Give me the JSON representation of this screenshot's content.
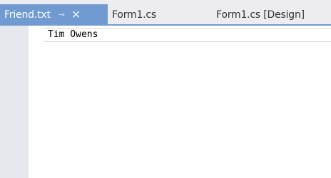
{
  "tabs": [
    {
      "label": "Friend.txt",
      "active": true,
      "pinned": false
    },
    {
      "label": "Form1.cs",
      "active": false
    },
    {
      "label": "Form1.cs [Design]",
      "active": false
    }
  ],
  "tab_icons": {
    "pin": "⊸",
    "close": "✕"
  },
  "editor": {
    "lines": [
      "Tim Owens"
    ]
  },
  "colors": {
    "active_tab": "#6f9bd1",
    "tabstrip_bg": "#ededf1",
    "gutter": "#e6e8ed"
  }
}
